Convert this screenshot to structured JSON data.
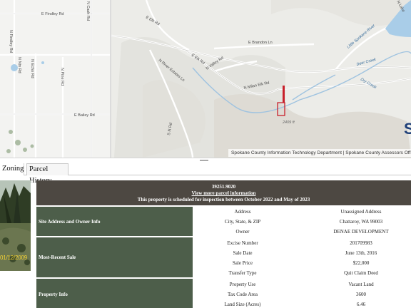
{
  "map": {
    "roads": {
      "e_findley_rd": "E Findley Rd",
      "n_findley_rd": "N Findley Rd",
      "n_cash_rd": "N Cash Rd",
      "n_echo_rd": "N Echo Rd",
      "n_ntn_rd": "N Ntn Rd",
      "n_pine_rd": "N Pine Rd",
      "e_bailey_rd": "E Bailey Rd",
      "n_river_estates_ln": "N River Estates Ln",
      "e_elk_rd": "E Elk Rd",
      "e_elk_rd_2": "E Elk Rd",
      "n_valley_rd": "N Valley Rd",
      "e_brandon_ln": "E Brandon Ln",
      "n_milan_elk_rd": "N Milan Elk Rd",
      "n_lake": "N Lake",
      "deer_creek": "Deer Creek",
      "little_spokane_river": "Little Spokane River",
      "dry_creek": "Dry Creek",
      "s_n_road": "S N Rd"
    },
    "elevation": "2409 ft",
    "attribution": "Spokane County Information Technology Department | Spokane County Assessors Office",
    "logo_letter": "S",
    "colors": {
      "parcel_outline": "#c8202b",
      "water": "#a9cde8",
      "roads": "#ffffff"
    }
  },
  "tabs": [
    {
      "label": "Zoning"
    },
    {
      "label": "Parcel History"
    }
  ],
  "photo": {
    "date_stamp": "01/12/2009"
  },
  "parcel": {
    "number": "39251.9020",
    "link": "View more parcel information",
    "notice": "This property is scheduled for inspection between October 2022 and May of 2023",
    "sections": {
      "address": "Site Address and Owner Info",
      "sale": "Most-Recent Sale",
      "property": "Property Info"
    },
    "rows": [
      {
        "key": "Address",
        "value": "Unassigned Address"
      },
      {
        "key": "City, State, & ZIP",
        "value": "Chattaroy, WA 99003"
      },
      {
        "key": "Owner",
        "value": "DENAE DEVELOPMENT"
      },
      {
        "key": "Excise Number",
        "value": "201709983"
      },
      {
        "key": "Sale Date",
        "value": "June 13th, 2016"
      },
      {
        "key": "Sale Price",
        "value": "$22,000"
      },
      {
        "key": "Transfer Type",
        "value": "Quit Claim Deed"
      },
      {
        "key": "Property Use",
        "value": "Vacant Land"
      },
      {
        "key": "Tax Code Area",
        "value": "3600"
      },
      {
        "key": "Land Size (Acres)",
        "value": "6.46"
      }
    ]
  }
}
